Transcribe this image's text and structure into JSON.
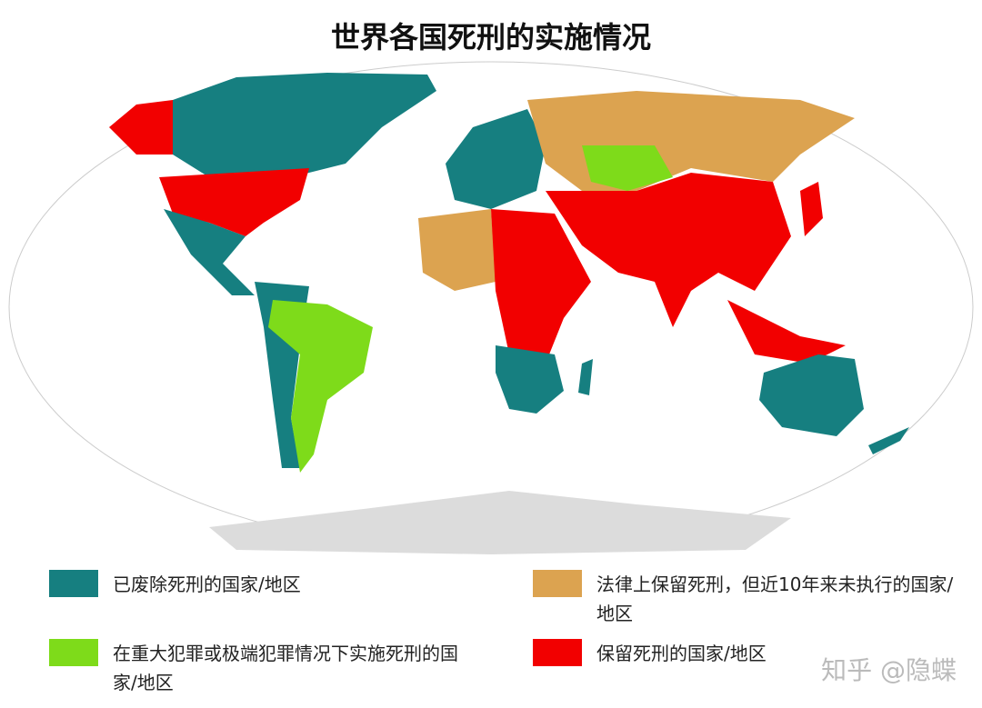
{
  "title": "世界各国死刑的实施情况",
  "colors": {
    "abolished": "#167f80",
    "extreme": "#7edb1a",
    "retained_unused": "#dca350",
    "retained": "#f20000",
    "antarctica": "#dcdcdc"
  },
  "legend": [
    {
      "key": "abolished",
      "label": "已废除死刑的国家/地区"
    },
    {
      "key": "retained_unused",
      "label": "法律上保留死刑，但近10年来未执行的国家/地区"
    },
    {
      "key": "extreme",
      "label": "在重大犯罪或极端犯罪情况下实施死刑的国家/地区"
    },
    {
      "key": "retained",
      "label": "保留死刑的国家/地区"
    }
  ],
  "watermark": "知乎 @隐蝶"
}
